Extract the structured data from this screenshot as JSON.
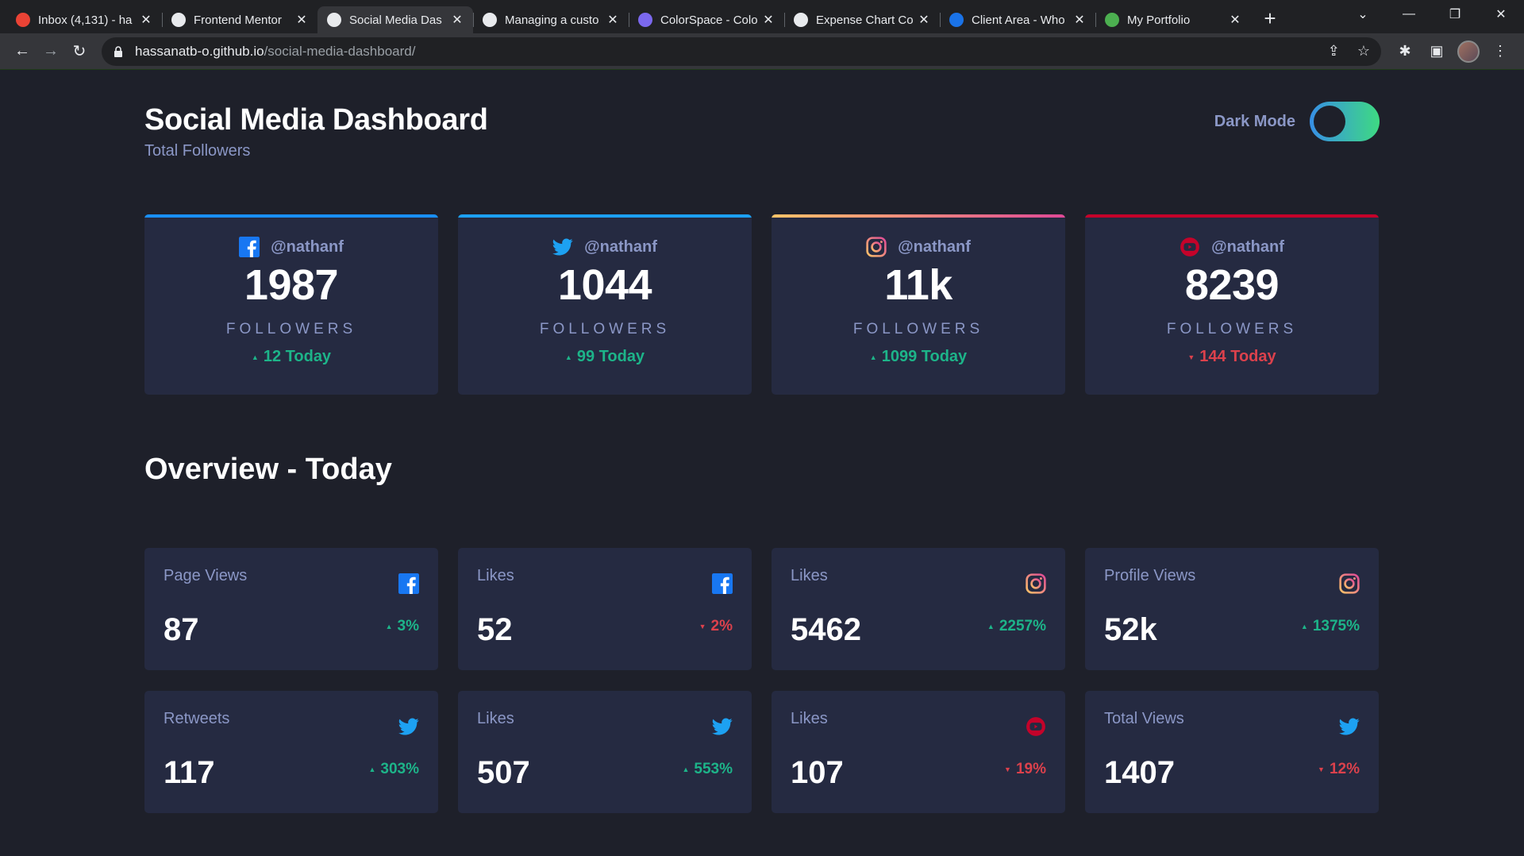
{
  "browser": {
    "tabs": [
      {
        "title": "Inbox (4,131) - ha",
        "icon": "gmail-icon",
        "active": false
      },
      {
        "title": "Frontend Mentor",
        "icon": "frontend-mentor-icon",
        "active": false
      },
      {
        "title": "Social Media Das",
        "icon": "globe-icon",
        "active": true
      },
      {
        "title": "Managing a custo",
        "icon": "github-icon",
        "active": false
      },
      {
        "title": "ColorSpace - Colo",
        "icon": "colorspace-icon",
        "active": false
      },
      {
        "title": "Expense Chart Co",
        "icon": "globe-icon",
        "active": false
      },
      {
        "title": "Client Area - Who",
        "icon": "client-area-icon",
        "active": false
      },
      {
        "title": "My Portfolio",
        "icon": "portfolio-icon",
        "active": false
      }
    ],
    "url_host": "hassanatb-o.github.io",
    "url_path": "/social-media-dashboard/"
  },
  "header": {
    "title": "Social Media Dashboard",
    "subtitle": "Total Followers",
    "mode_label": "Dark Mode"
  },
  "followers_cards": [
    {
      "platform": "facebook",
      "handle": "@nathanf",
      "count": "1987",
      "label": "FOLLOWERS",
      "today": "12 Today",
      "trend": "up",
      "accent": "#198ff5"
    },
    {
      "platform": "twitter",
      "handle": "@nathanf",
      "count": "1044",
      "label": "FOLLOWERS",
      "today": "99 Today",
      "trend": "up",
      "accent": "#1ca0f2"
    },
    {
      "platform": "instagram",
      "handle": "@nathanf",
      "count": "11k",
      "label": "FOLLOWERS",
      "today": "1099 Today",
      "trend": "up",
      "accent": "#fdc468"
    },
    {
      "platform": "youtube",
      "handle": "@nathanf",
      "count": "8239",
      "label": "FOLLOWERS",
      "today": "144 Today",
      "trend": "down",
      "accent": "#c4032a"
    }
  ],
  "overview": {
    "title": "Overview - Today",
    "items": [
      {
        "metric": "Page Views",
        "platform": "facebook",
        "value": "87",
        "change": "3%",
        "trend": "up"
      },
      {
        "metric": "Likes",
        "platform": "facebook",
        "value": "52",
        "change": "2%",
        "trend": "down"
      },
      {
        "metric": "Likes",
        "platform": "instagram",
        "value": "5462",
        "change": "2257%",
        "trend": "up"
      },
      {
        "metric": "Profile Views",
        "platform": "instagram",
        "value": "52k",
        "change": "1375%",
        "trend": "up"
      },
      {
        "metric": "Retweets",
        "platform": "twitter",
        "value": "117",
        "change": "303%",
        "trend": "up"
      },
      {
        "metric": "Likes",
        "platform": "twitter",
        "value": "507",
        "change": "553%",
        "trend": "up"
      },
      {
        "metric": "Likes",
        "platform": "youtube",
        "value": "107",
        "change": "19%",
        "trend": "down"
      },
      {
        "metric": "Total Views",
        "platform": "twitter",
        "value": "1407",
        "change": "12%",
        "trend": "down"
      }
    ]
  },
  "colors": {
    "background": "#1e202a",
    "card": "#252a41",
    "text_muted": "#8b97c6",
    "up": "#1db489",
    "down": "#dc414c"
  }
}
